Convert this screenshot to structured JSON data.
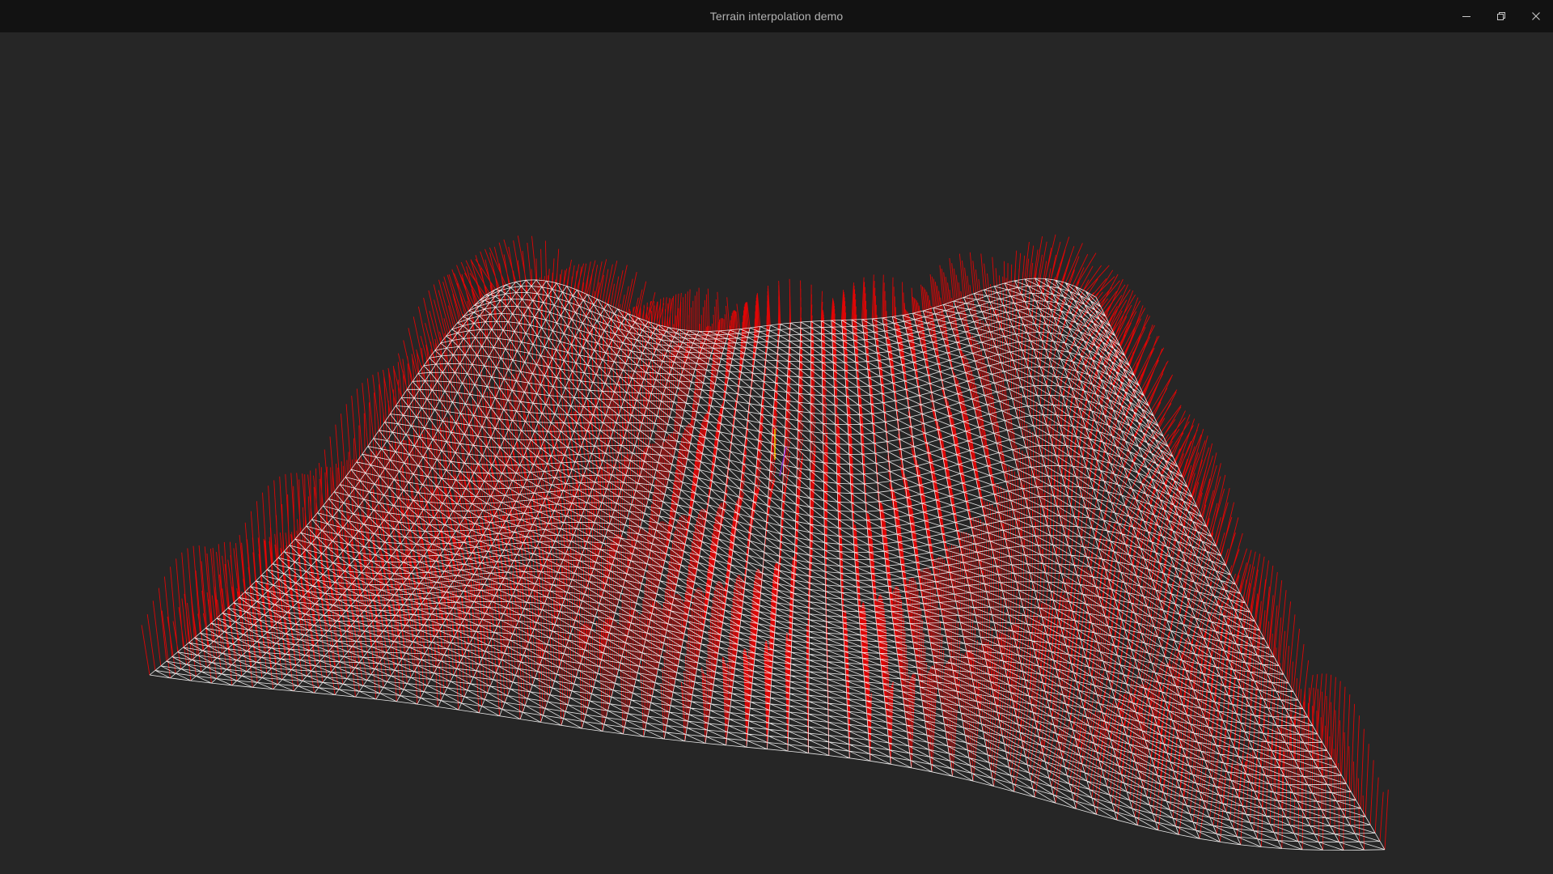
{
  "window": {
    "title": "Terrain interpolation demo",
    "controls": [
      "minimize-icon",
      "restore-icon",
      "close-icon"
    ]
  },
  "scene": {
    "background": "#262626",
    "titlebar_color": "#121212",
    "mesh_color": "#ffffff",
    "normal_color": "#ff0000",
    "axis_colors": [
      "#ffff00",
      "#8a2be2"
    ],
    "render_mode": "wireframe-with-normals"
  }
}
